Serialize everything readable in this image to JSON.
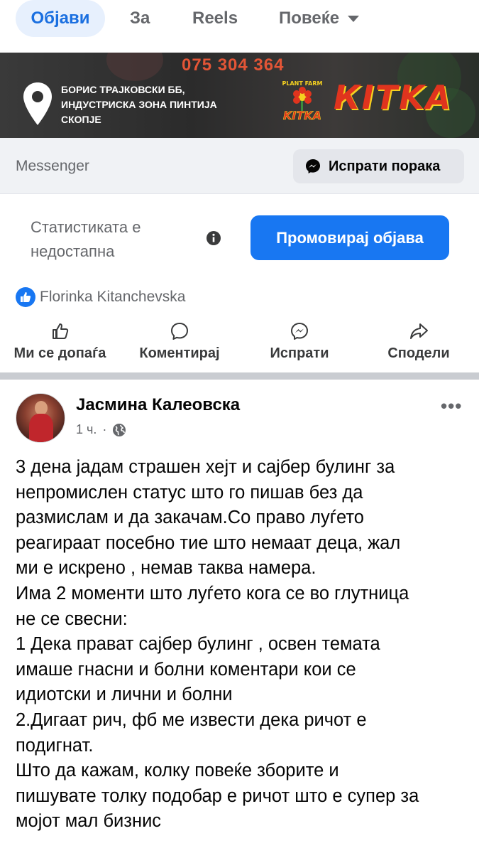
{
  "tabs": [
    {
      "label": "Објави",
      "active": true
    },
    {
      "label": "За"
    },
    {
      "label": "Reels"
    },
    {
      "label": "Повеќе"
    }
  ],
  "banner": {
    "phone": "075 304 364",
    "address_lines": [
      "БОРИС ТРАЈКОВСКИ ББ,",
      "ИНДУСТРИСКА ЗОНА ПИНТИЈА",
      "СКОПЈЕ"
    ],
    "logo_small_top": "PLANT FARM",
    "logo_small": "КITKA",
    "logo_text": "КITKA"
  },
  "messenger": {
    "label": "Messenger",
    "send_button": "Испрати порака"
  },
  "stats": {
    "text_line1": "Статистиката е",
    "text_line2": "недостапна",
    "promote_button": "Промовирај објава"
  },
  "reactions": {
    "names": "Florinka Kitanchevska"
  },
  "actions": {
    "like": "Ми се допаѓа",
    "comment": "Коментирај",
    "send": "Испрати",
    "share": "Сподели"
  },
  "post": {
    "author": "Јасмина Калеовска",
    "time": "1 ч.",
    "body_lines": [
      "3 дена јадам страшен хејт и сајбер булинг за",
      "непромислен статус што го пишав без да",
      "размислам и да закачам.Со право луѓето",
      "реагираат посебно тие што немаат деца, жал",
      "ми е искрено , немав таква намера.",
      "Има 2 моменти што луѓето кога се во глутница",
      "не се свесни:",
      "1 Дека прават сајбер булинг , освен темата",
      "имаше гнасни и болни коментари кои се",
      "идиотски и  лични и болни",
      "2.Дигаат рич, фб ме извести дека ричот е",
      "подигнат.",
      "Што да кажам, колку повеќе зборите и",
      "пишувате толку подобар е ричот што е супер за",
      "мојот мал бизнис"
    ]
  },
  "colors": {
    "accent": "#1877f2",
    "tab_active_bg": "#e7f0fd",
    "secondary_text": "#65676b",
    "banner_phone": "#e35536",
    "logo_red": "#e0341e"
  }
}
